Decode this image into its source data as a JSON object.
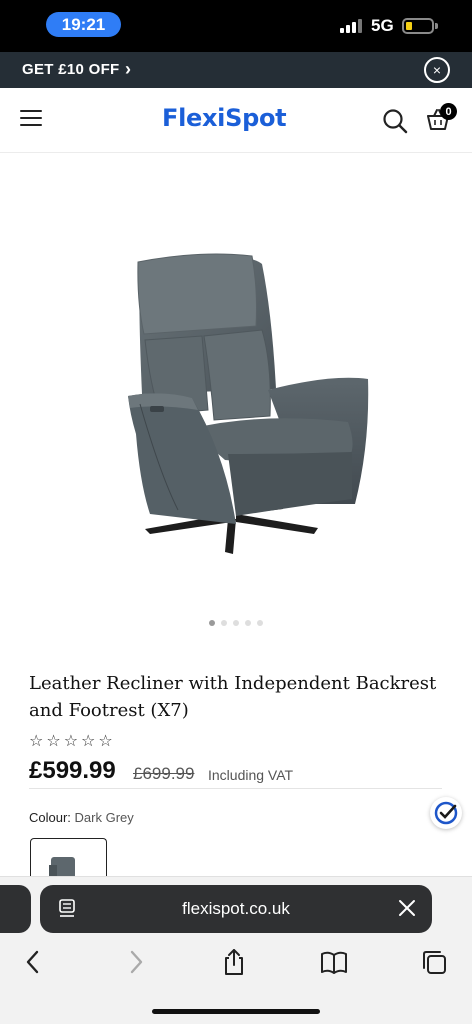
{
  "status": {
    "time": "19:21",
    "network": "5G"
  },
  "promo": {
    "text": "GET £10 OFF",
    "chevron": "›",
    "close": "×"
  },
  "header": {
    "logo": "FlexiSpot",
    "cart_count": "0",
    "icons": [
      "menu-icon",
      "search-icon",
      "cart-icon"
    ]
  },
  "carousel": {
    "total_slides": 5,
    "active_slide": 1
  },
  "product": {
    "title": "Leather Recliner with Independent Backrest and Footrest (X7)",
    "rating_stars": "☆☆☆☆☆",
    "price": "£599.99",
    "old_price": "£699.99",
    "vat_note": "Including VAT",
    "colour_label": "Colour:",
    "colour_value": "Dark Grey"
  },
  "browser": {
    "url": "flexispot.co.uk",
    "icons": [
      "back-icon",
      "forward-icon",
      "share-icon",
      "bookmarks-icon",
      "tabs-icon"
    ]
  },
  "colors": {
    "brand": "#1b5fd8",
    "promo_bg": "#252e36",
    "time_pill": "#2f7df6",
    "url_bar": "#2f3032"
  }
}
